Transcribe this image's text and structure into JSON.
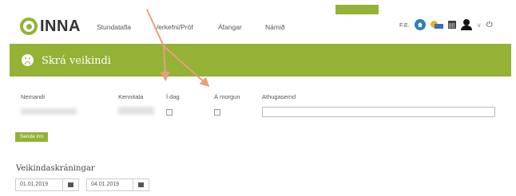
{
  "header": {
    "logo_text": "INNA",
    "nav": [
      "Stundatafla",
      "Verkefni/Próf",
      "Áfangar",
      "Námið"
    ],
    "tab_label": "",
    "user_initials": "F.E."
  },
  "banner": {
    "title": "Skrá veikindi",
    "color": "#93b236"
  },
  "form": {
    "columns": {
      "student": "Nemandi",
      "ssn": "Kennitala",
      "today": "Í dag",
      "tomorrow": "Á morgun",
      "note": "Athugasemd"
    },
    "submit_label": "Senda inn"
  },
  "history": {
    "title": "Veikindaskráningar",
    "date_from": "01.01.2019",
    "date_to": "04.01.2019"
  },
  "icons": [
    "home-icon",
    "grade-icon",
    "calendar-icon",
    "user-icon",
    "chevron-down-icon",
    "power-icon",
    "sad-face-icon"
  ]
}
